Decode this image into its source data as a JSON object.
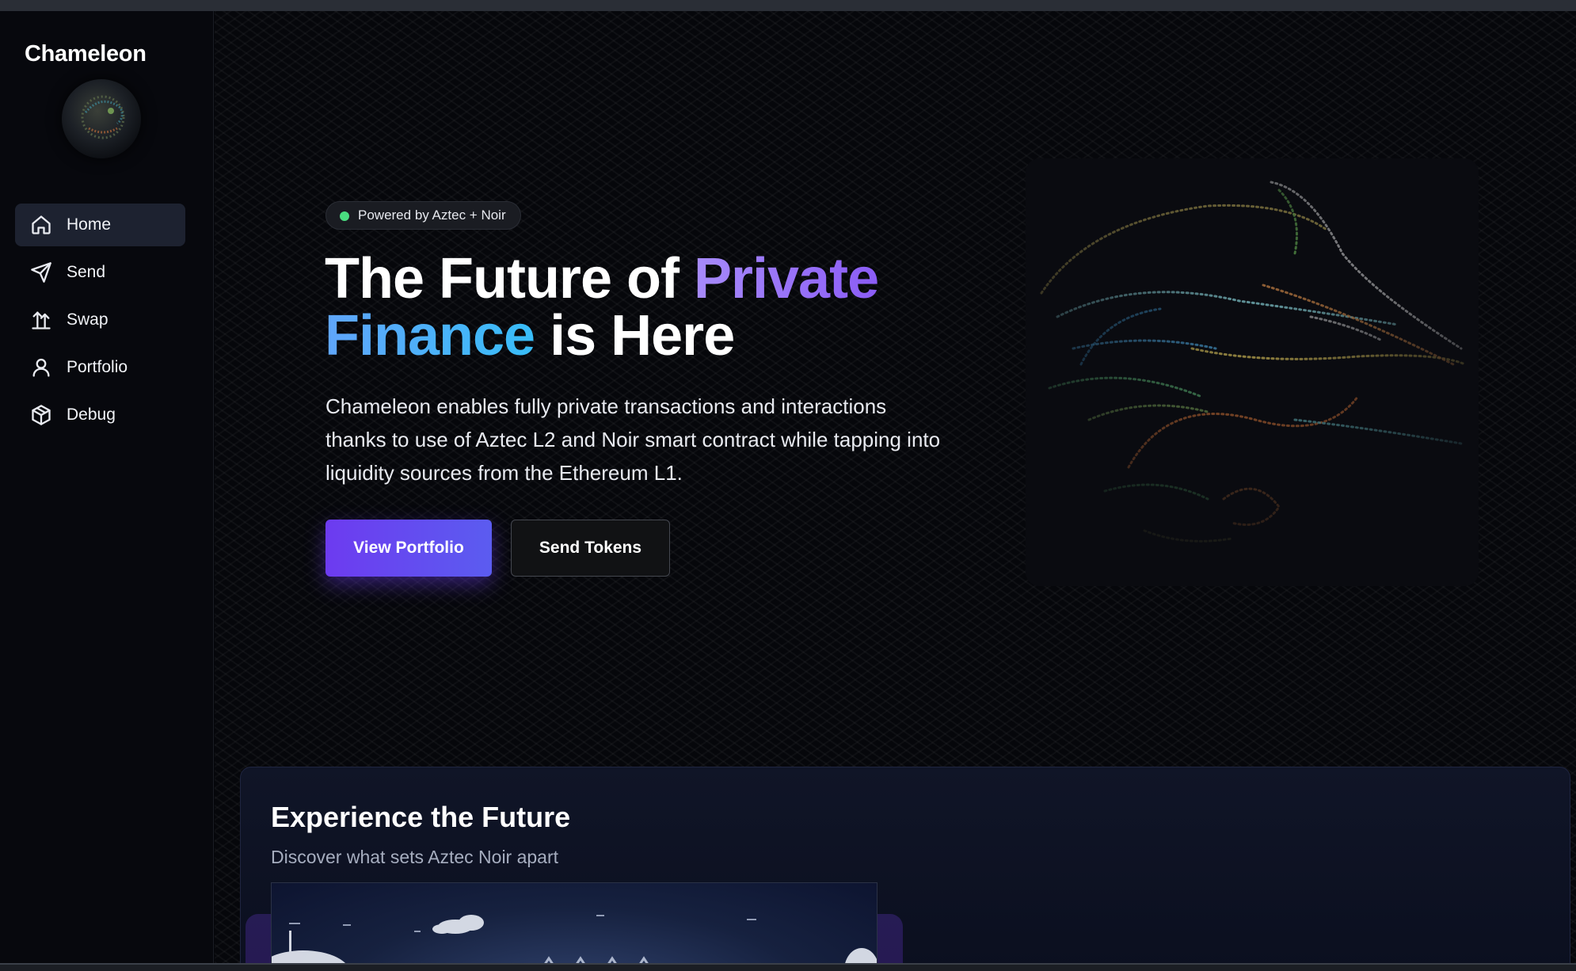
{
  "app": {
    "name": "Chameleon"
  },
  "sidebar": {
    "items": [
      {
        "label": "Home",
        "icon": "home-icon",
        "active": true
      },
      {
        "label": "Send",
        "icon": "send-icon",
        "active": false
      },
      {
        "label": "Swap",
        "icon": "swap-icon",
        "active": false
      },
      {
        "label": "Portfolio",
        "icon": "user-icon",
        "active": false
      },
      {
        "label": "Debug",
        "icon": "cube-icon",
        "active": false
      }
    ]
  },
  "hero": {
    "badge": "Powered by Aztec + Noir",
    "headline": {
      "part1": "The Future of ",
      "highlight1": "Private",
      "highlight2": "Finance",
      "part2": " is Here"
    },
    "description": "Chameleon enables fully private transactions and interactions thanks to use of Aztec L2 and Noir smart contract while tapping into liquidity sources from the Ethereum L1.",
    "primary_button": "View Portfolio",
    "secondary_button": "Send Tokens"
  },
  "feature": {
    "title": "Experience the Future",
    "subtitle": "Discover what sets Aztec Noir apart"
  },
  "colors": {
    "accent": "#6d3bf0",
    "gradient_purple": "#a78bfa",
    "gradient_blue": "#60a5fa",
    "status_dot": "#4ade80"
  }
}
